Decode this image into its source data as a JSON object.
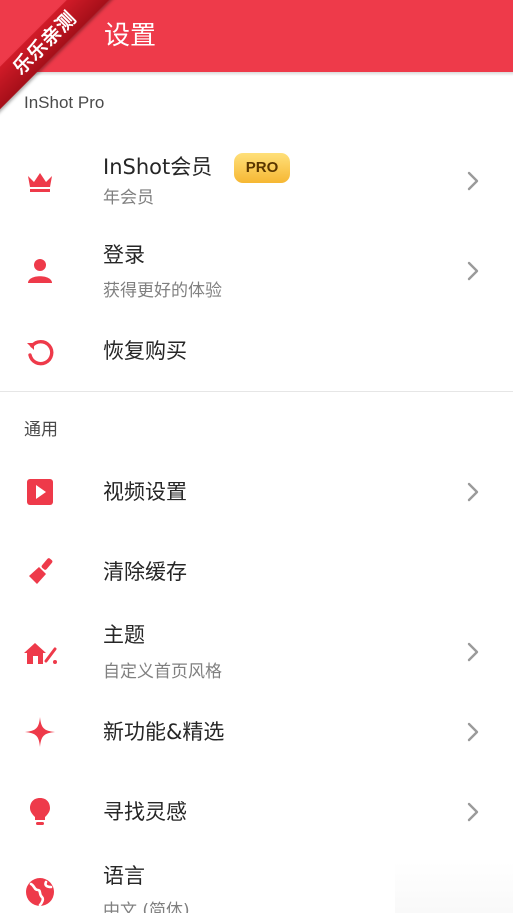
{
  "header": {
    "title": "设置"
  },
  "watermark": {
    "text": "乐乐亲测"
  },
  "sections": {
    "pro_title": "InShot Pro",
    "general_title": "通用"
  },
  "items": {
    "membership": {
      "label": "InShot会员",
      "sublabel": "年会员",
      "badge": "PRO",
      "icon": "crown-icon"
    },
    "login": {
      "label": "登录",
      "sublabel": "获得更好的体验",
      "icon": "user-icon"
    },
    "restore": {
      "label": "恢复购买",
      "icon": "restore-icon"
    },
    "video_settings": {
      "label": "视频设置",
      "icon": "play-icon"
    },
    "clear_cache": {
      "label": "清除缓存",
      "icon": "broom-icon"
    },
    "theme": {
      "label": "主题",
      "sublabel": "自定义首页风格",
      "icon": "theme-house-icon"
    },
    "new_features": {
      "label": "新功能&精选",
      "icon": "sparkle-icon"
    },
    "inspiration": {
      "label": "寻找灵感",
      "icon": "lightbulb-icon"
    },
    "language": {
      "label": "语言",
      "sublabel": "中文 (简体)",
      "icon": "globe-icon"
    }
  },
  "colors": {
    "accent": "#ee3a4a",
    "badge": "#f6b733",
    "ribbon": "#c4141f"
  }
}
